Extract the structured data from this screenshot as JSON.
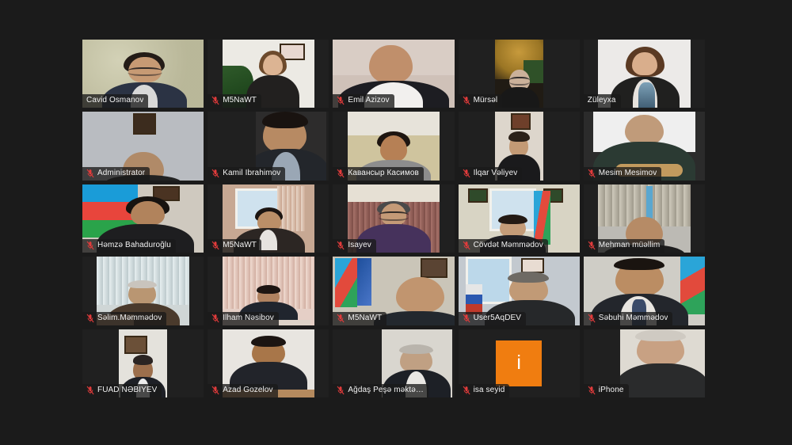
{
  "app": {
    "name": "video-conference-gallery",
    "background_color": "#1b1b1b",
    "tile_background_color": "#202020",
    "active_speaker_border_color": "#7ee627",
    "name_label_background": "rgba(26,26,26,0.78)",
    "name_label_text_color": "#f2f2f2",
    "muted_icon_color": "#e03b3b",
    "avatar_color": "#f07d10",
    "columns": 5,
    "rows": 5
  },
  "participants": [
    {
      "name": "Cavid Osmanov",
      "muted": false,
      "active_speaker": true,
      "video_on": true,
      "avatar_initial": ""
    },
    {
      "name": "M5NaWT",
      "muted": true,
      "active_speaker": false,
      "video_on": true,
      "avatar_initial": ""
    },
    {
      "name": "Emil Azizov",
      "muted": true,
      "active_speaker": false,
      "video_on": true,
      "avatar_initial": ""
    },
    {
      "name": "Mürsəl",
      "muted": true,
      "active_speaker": false,
      "video_on": true,
      "avatar_initial": ""
    },
    {
      "name": "Züleyxa",
      "muted": false,
      "active_speaker": false,
      "video_on": true,
      "avatar_initial": ""
    },
    {
      "name": "Administrator",
      "muted": true,
      "active_speaker": false,
      "video_on": true,
      "avatar_initial": ""
    },
    {
      "name": "Kamil İbrahimov",
      "muted": true,
      "active_speaker": false,
      "video_on": true,
      "avatar_initial": ""
    },
    {
      "name": "Кавансыр Касимов",
      "muted": true,
      "active_speaker": false,
      "video_on": true,
      "avatar_initial": ""
    },
    {
      "name": "İlqar Vəliyev",
      "muted": true,
      "active_speaker": false,
      "video_on": true,
      "avatar_initial": ""
    },
    {
      "name": "Mesim Mesimov",
      "muted": true,
      "active_speaker": false,
      "video_on": true,
      "avatar_initial": ""
    },
    {
      "name": "Həmzə Bahaduroğlu",
      "muted": true,
      "active_speaker": false,
      "video_on": true,
      "avatar_initial": ""
    },
    {
      "name": "M5NaWT",
      "muted": true,
      "active_speaker": false,
      "video_on": true,
      "avatar_initial": ""
    },
    {
      "name": "İsayev",
      "muted": true,
      "active_speaker": false,
      "video_on": true,
      "avatar_initial": ""
    },
    {
      "name": "Cövdət Məmmədov",
      "muted": true,
      "active_speaker": false,
      "video_on": true,
      "avatar_initial": ""
    },
    {
      "name": "Mehman müəllim",
      "muted": true,
      "active_speaker": false,
      "video_on": true,
      "avatar_initial": ""
    },
    {
      "name": "Səlim.Məmmədov",
      "muted": true,
      "active_speaker": false,
      "video_on": true,
      "avatar_initial": ""
    },
    {
      "name": "İlham Nəsibov",
      "muted": true,
      "active_speaker": false,
      "video_on": true,
      "avatar_initial": ""
    },
    {
      "name": "M5NaWT",
      "muted": true,
      "active_speaker": false,
      "video_on": true,
      "avatar_initial": ""
    },
    {
      "name": "User5AqDEV",
      "muted": true,
      "active_speaker": false,
      "video_on": true,
      "avatar_initial": ""
    },
    {
      "name": "Səbuhi Məmmədov",
      "muted": true,
      "active_speaker": false,
      "video_on": true,
      "avatar_initial": ""
    },
    {
      "name": "FUAD NƏBIYEV",
      "muted": true,
      "active_speaker": false,
      "video_on": true,
      "avatar_initial": ""
    },
    {
      "name": "Azad Gozelov",
      "muted": true,
      "active_speaker": false,
      "video_on": true,
      "avatar_initial": ""
    },
    {
      "name": "Ağdaş Peşə məktə…",
      "muted": true,
      "active_speaker": false,
      "video_on": true,
      "avatar_initial": ""
    },
    {
      "name": "isa seyid",
      "muted": true,
      "active_speaker": false,
      "video_on": false,
      "avatar_initial": "i"
    },
    {
      "name": "iPhone",
      "muted": true,
      "active_speaker": false,
      "video_on": true,
      "avatar_initial": ""
    }
  ]
}
